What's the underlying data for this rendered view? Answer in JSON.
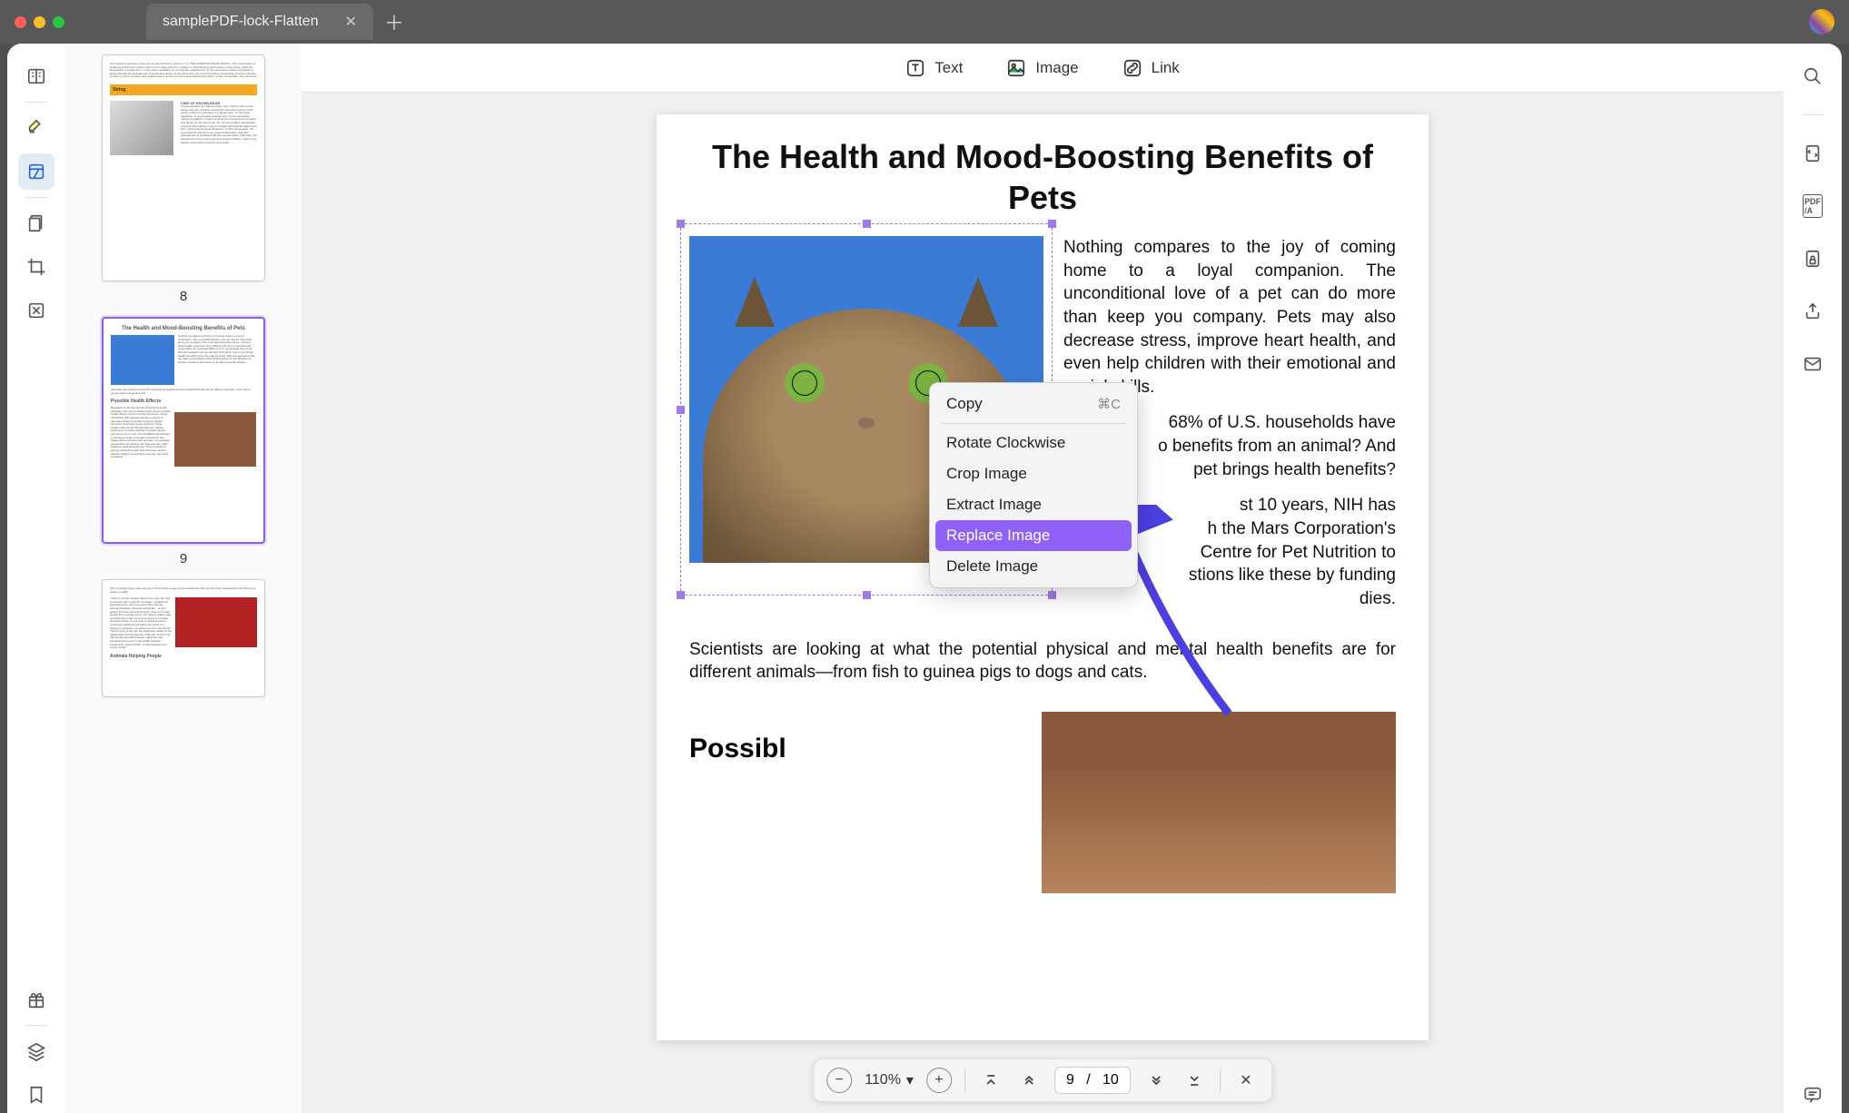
{
  "titlebar": {
    "tab_title": "samplePDF-lock-Flatten"
  },
  "edit_toolbar": {
    "text": "Text",
    "image": "Image",
    "link": "Link"
  },
  "thumbnails": {
    "page8": "8",
    "page9": "9"
  },
  "document": {
    "title": "The Health and Mood-Boosting Benefits of Pets",
    "para1": "Nothing compares to the joy of coming home to a loyal companion. The unconditional love of a pet can do more than keep you company. Pets may also decrease stress, improve heart health,  and  even  help children  with  their emotional and social skills.",
    "para2_partial_a": "68% of U.S. households have",
    "para2_partial_b": "o benefits from an animal? And",
    "para2_partial_c": "pet brings health benefits?",
    "para3_a": "st  10  years,  NIH  has",
    "para3_b": "h the Mars Corporation's",
    "para3_c": "Centre  for  Pet  Nutrition  to",
    "para3_d": "stions  like these by funding",
    "para3_e": "dies.",
    "para4": "Scientists are looking at what the potential physical and mental health benefits are for different animals—from fish to guinea pigs to dogs and cats.",
    "subheading": "Possibl"
  },
  "context_menu": {
    "copy": "Copy",
    "copy_shortcut": "⌘C",
    "rotate": "Rotate Clockwise",
    "crop": "Crop Image",
    "extract": "Extract Image",
    "replace": "Replace Image",
    "delete": "Delete Image"
  },
  "bottom_bar": {
    "zoom": "110%",
    "page_current": "9",
    "page_sep": "/",
    "page_total": "10"
  },
  "thumb8": {
    "string_label": "String",
    "lok": "LINE OF KNOWLEDGE"
  },
  "thumb9": {
    "title": "The Health and Mood-Boosting Benefits of Pets",
    "sub": "Possible Health Effects"
  },
  "thumb10": {
    "sub": "Animals Helping People"
  }
}
